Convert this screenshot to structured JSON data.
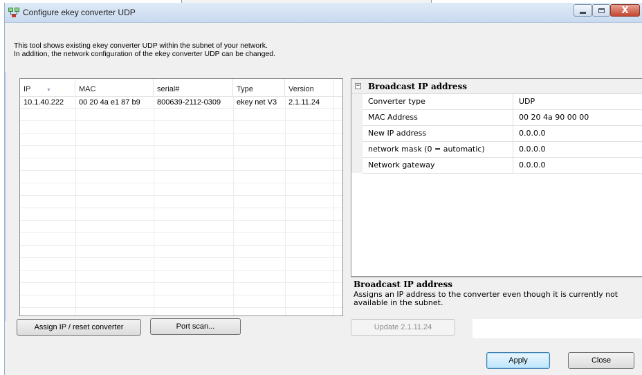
{
  "window": {
    "title": "Configure ekey converter UDP",
    "close_glyph": "X"
  },
  "description": {
    "line1": "This tool shows existing ekey converter UDP within the subnet of your network.",
    "line2": "In addition, the network configuration of the ekey converter UDP can be changed."
  },
  "device_list": {
    "columns": [
      "IP",
      "MAC",
      "serial#",
      "Type",
      "Version"
    ],
    "rows": [
      {
        "ip": "10.1.40.222",
        "mac": "00 20 4a e1 87 b9",
        "serial": "800639-2112-0309",
        "type": "ekey net V3",
        "version": "2.1.11.24"
      }
    ]
  },
  "properties": {
    "category": "Broadcast IP address",
    "expander_glyph": "−",
    "rows": [
      {
        "name": "Converter type",
        "value": "UDP"
      },
      {
        "name": "MAC Address",
        "value": "00 20 4a 90 00 00"
      },
      {
        "name": "New IP address",
        "value": "0.0.0.0"
      },
      {
        "name": "network mask (0 = automatic)",
        "value": "0.0.0.0"
      },
      {
        "name": "Network gateway",
        "value": "0.0.0.0"
      }
    ]
  },
  "help": {
    "title": "Broadcast IP address",
    "text": "Assigns an IP address to the converter even though it is currently not available in the subnet."
  },
  "buttons": {
    "assign": "Assign IP / reset converter",
    "port_scan": "Port scan...",
    "update": "Update 2.1.11.24",
    "apply": "Apply",
    "close": "Close"
  }
}
